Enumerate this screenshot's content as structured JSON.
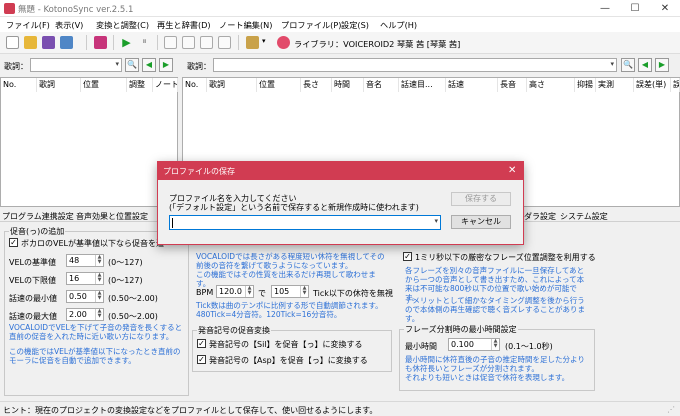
{
  "window": {
    "title": "無題 - KotonoSync ver.2.5.1",
    "minimize_icon": "—",
    "maximize_icon": "☐",
    "close_icon": "✕"
  },
  "menu": [
    "ファイル(F)",
    "表示(V)",
    "変換と調整(C)",
    "再生と辞書(D)",
    "ノート編集(N)",
    "プロファイル(P)",
    "設定(S)",
    "ヘルプ(H)"
  ],
  "toolbar": {
    "library_label": "ライブラリ：VOICEROID2 琴葉 茜 [琴葉 茜]",
    "play_icon": "▶",
    "pause_icon": "⏸"
  },
  "lyrics_bar": {
    "left_label": "歌詞：",
    "right_label": "歌詞：",
    "search_icon": "🔍",
    "prev_icon": "◀",
    "next_icon": "▶"
  },
  "left_table": {
    "columns": [
      "No.",
      "歌詞",
      "位置",
      "調整",
      "ノート"
    ]
  },
  "right_table": {
    "columns": [
      "No.",
      "歌詞",
      "位置",
      "長さ",
      "時間",
      "音名",
      "話速目...",
      "話速",
      "長音",
      "高さ",
      "抑揚",
      "実測",
      "誤差(単)",
      "誤"
    ]
  },
  "left_tabs": [
    "プログラム連携設定",
    "音声効果と位置設定"
  ],
  "right_tabs": [
    "ダラ設定",
    "システム設定"
  ],
  "sokuon": {
    "group_title": "促音(っ)の追加",
    "check_label": "ボカロのVELが基準値以下なら促音を追",
    "vel_base_label": "VELの基準値",
    "vel_base_value": "48",
    "vel_base_range": "(0～127)",
    "vel_lower_label": "VELの下限値",
    "vel_lower_value": "16",
    "vel_lower_range": "(0～127)",
    "speed_min_label": "話速の最小値",
    "speed_min_value": "0.50",
    "speed_min_range": "(0.50～2.00)",
    "speed_max_label": "話速の最大値",
    "speed_max_value": "2.00",
    "speed_max_range": "(0.50～2.00)",
    "note1": "VOCALOIDでVELを下げて子音の発音を長くすると直前の促音を入れた時に近い歌い方になります。",
    "note2": "この機能ではVELが基準値以下になったとき直前のモーラに促音を自動で追加できます。"
  },
  "rest": {
    "note1": "VOCALOIDでは長さがある程度短い休符を無視してその前後の音符を繋げて歌うようになっています。",
    "note2": "この機能ではその性質を出来るだけ再現して歌わせます。",
    "bpm_label": "BPM",
    "bpm_value": "120.0",
    "de_label": "で",
    "tick_value": "105",
    "tick_label": "Tick以下の休符を無視",
    "tick_note1": "Tick数は曲のテンポに比例する形で自動調節されます。",
    "tick_note2": "480Tick=4分音符。120Tick=16分音符。"
  },
  "symbol": {
    "group_title": "発音記号の促音変換",
    "check1_label": "発音記号の【Sil】を促音【っ】に変換する",
    "check2_label": "発音記号の【Asp】を促音【っ】に変換する"
  },
  "phrase": {
    "check_label": "1ミリ秒以下の厳密なフレーズ位置調整を利用する",
    "note1": "各フレーズを別々の音声ファイルに一旦保存してあとから一つの音声として書き出すため、これによって本来は不可能な800秒以下の位置で歌い始めが可能です。",
    "note2": "デメリットとして細かなタイミング調整を後から行うので本体側の再生確認で聴く音ズレすることがあります。"
  },
  "phrase_min": {
    "group_title": "フレーズ分割時の最小時間設定",
    "label": "最小時間",
    "value": "0.100",
    "range": "(0.1～1.0秒)",
    "note1": "最小時間に休符直後の子音の推定時間を足した分よりも休符長いとフレーズが分割されます。",
    "note2": "それよりも短いときは促音で休符を表現します。"
  },
  "status": {
    "hint": "ヒント：現在のプロジェクトの変換設定などをプロファイルとして保存して、使い回せるようにします。"
  },
  "dialog": {
    "title": "プロファイルの保存",
    "close_icon": "✕",
    "prompt_line1": "プロファイル名を入力してください",
    "prompt_line2": "(「デフォルト設定」という名前で保存すると新規作成時に使われます)",
    "input_value": "",
    "save_label": "保存する",
    "cancel_label": "キャンセル"
  },
  "colors": {
    "accent": "#d13c52",
    "hint_text": "#2b6fd6"
  }
}
